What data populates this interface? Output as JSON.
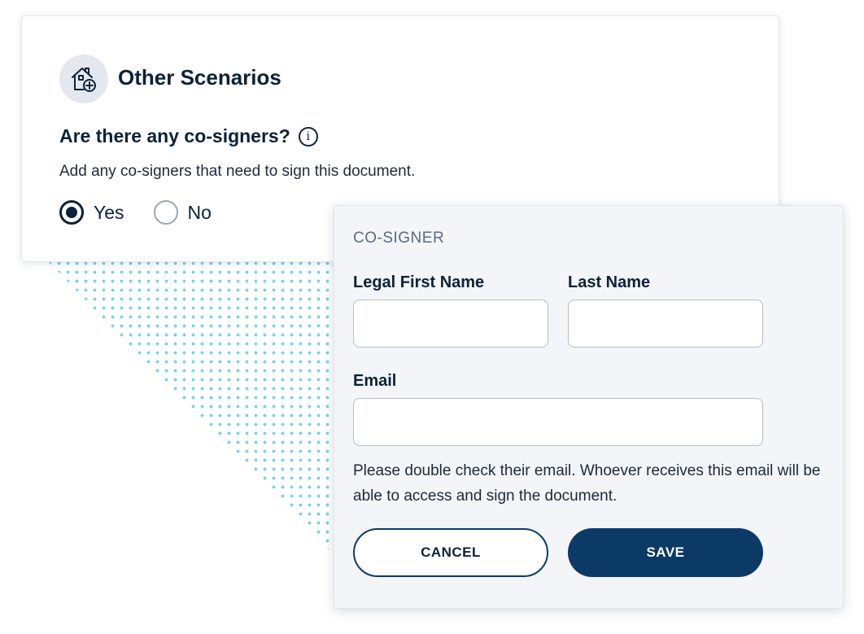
{
  "scenario_card": {
    "icon": "house-plus-icon",
    "title": "Other Scenarios",
    "question": "Are there any co-signers?",
    "info_icon": "info-icon",
    "helper_text": "Add any co-signers that need to sign this document.",
    "radio_options": [
      {
        "label": "Yes",
        "selected": true
      },
      {
        "label": "No",
        "selected": false
      }
    ]
  },
  "cosigner_form": {
    "section_label": "CO-SIGNER",
    "first_name_label": "Legal First Name",
    "first_name_value": "",
    "last_name_label": "Last Name",
    "last_name_value": "",
    "email_label": "Email",
    "email_value": "",
    "note": "Please double check their email. Whoever receives this email will be able to access and sign the document.",
    "cancel_label": "CANCEL",
    "save_label": "SAVE"
  },
  "colors": {
    "primary_navy": "#0b3a66",
    "text_dark": "#0b2239",
    "dot_pattern": "#6fd0ee",
    "panel_bg": "#f3f5f8"
  }
}
